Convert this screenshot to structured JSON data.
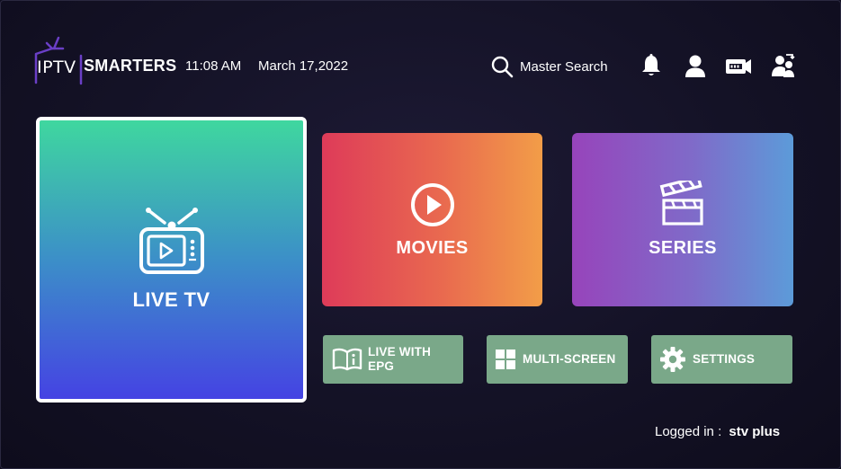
{
  "app": {
    "logo_left": "IPTV",
    "logo_right": "SMARTERS"
  },
  "header": {
    "time": "11:08 AM",
    "date": "March 17,2022",
    "search_label": "Master Search",
    "icons": [
      "bell-icon",
      "user-icon",
      "record-icon",
      "switch-user-icon"
    ]
  },
  "tiles": {
    "live_tv": "LIVE TV",
    "movies": "MOVIES",
    "series": "SERIES"
  },
  "shortcuts": {
    "live_epg": "LIVE WITH EPG",
    "multi_screen": "MULTI-SCREEN",
    "settings": "SETTINGS"
  },
  "footer": {
    "logged_in_label": "Logged in :",
    "username": "stv plus"
  },
  "colors": {
    "background": "#141226",
    "shortcut_green": "#7aa889",
    "logo_accent": "#6a3fc6"
  }
}
